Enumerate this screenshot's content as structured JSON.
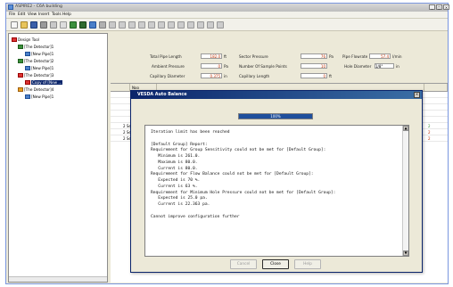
{
  "window": {
    "title": "ASPIRE2 - C6A building",
    "min": "_",
    "max": "□",
    "close": "×"
  },
  "menu": [
    "File",
    "Edit",
    "View",
    "Insert",
    "Tools",
    "Help"
  ],
  "tree": {
    "items": [
      {
        "label": "Design Tool",
        "level": 0,
        "selected": false
      },
      {
        "label": "[The Detector]1",
        "level": 1,
        "selected": false
      },
      {
        "label": "[New Pipe]1",
        "level": 2,
        "selected": false
      },
      {
        "label": "[The Detector]2",
        "level": 1,
        "selected": false
      },
      {
        "label": "[New Pipe]1",
        "level": 2,
        "selected": false
      },
      {
        "label": "[The Detector]3",
        "level": 1,
        "selected": false
      },
      {
        "label": "Copy of [New ...",
        "level": 2,
        "selected": true
      },
      {
        "label": "[The Detector]4",
        "level": 1,
        "selected": false
      },
      {
        "label": "[New Pipe]1",
        "level": 2,
        "selected": false
      }
    ]
  },
  "form": {
    "total_pipe_length": {
      "label": "Total Pipe Length",
      "value": "182.0",
      "unit": "ft"
    },
    "sector_pressure": {
      "label": "Sector Pressure",
      "value": "76",
      "unit": "Pa"
    },
    "pipe_flowrate": {
      "label": "Pipe Flowrate",
      "value": "57.4",
      "unit": "l/min"
    },
    "ambient_pressure": {
      "label": "Ambient Pressure",
      "value": "0",
      "unit": "Pa"
    },
    "sample_points": {
      "label": "Number Of Sample Points",
      "value": "10",
      "unit": ""
    },
    "hole_diameter": {
      "label": "Hole Diameter",
      "value": "1/8\"",
      "unit": "in"
    },
    "capillary_diameter": {
      "label": "Capillary Diameter",
      "value": "0.375",
      "unit": "in"
    },
    "capillary_length": {
      "label": "Capillary Length",
      "value": "0",
      "unit": "ft"
    }
  },
  "grid": {
    "header_first": "Noo",
    "rows": [
      {
        "c1": "",
        "c2": ""
      },
      {
        "c1": "",
        "c2": ""
      },
      {
        "c1": "",
        "c2": ""
      },
      {
        "c1": "",
        "c2": ""
      },
      {
        "c1": "",
        "c2": ""
      },
      {
        "c1": "2 Sect",
        "c2": "2"
      },
      {
        "c1": "2 Sect",
        "c2": "2"
      },
      {
        "c1": "2 Sect",
        "c2": "2"
      }
    ]
  },
  "dialog": {
    "title": "VESDA Auto Balance",
    "progress_percent": 100,
    "progress_label": "100%",
    "report_lines": [
      "Iteration limit has been reached",
      "",
      "[Default Group] Report:",
      "Requirement for Group Sensitivity could not be met for [Default Group]:",
      "   Minimum is 261.0.",
      "   Maximum is 80.0.",
      "   Current is 80.0.",
      "Requirement for Flow Balance could not be met for [Default Group]:",
      "   Expected is 70 %.",
      "   Current is 63 %.",
      "Requirement for Minimum Hole Pressure could not be met for [Default Group]:",
      "   Expected is 25.0 pa.",
      "   Current is 22.363 pa.",
      "",
      "Cannot improve configuration further"
    ],
    "buttons": {
      "cancel": "Cancel",
      "close": "Close",
      "help": "Help"
    }
  },
  "colors": {
    "accent": "#0a246a",
    "progress": "#1f4f9c",
    "grid_value": "#c03000"
  }
}
